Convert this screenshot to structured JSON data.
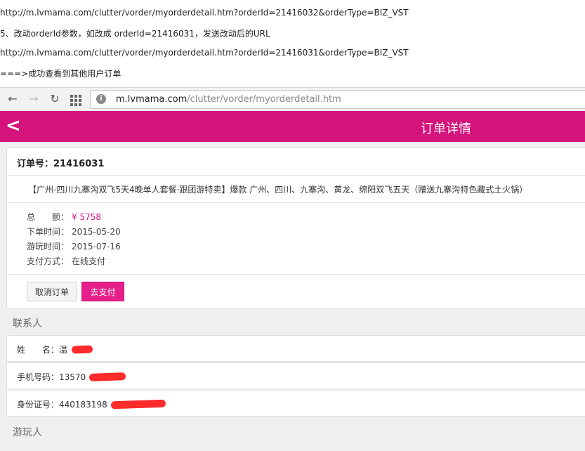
{
  "notes": {
    "line1": "http://m.lvmama.com/clutter/vorder/myorderdetail.htm?orderId=21416032&orderType=BIZ_VST",
    "line2": "5、改动orderId参数，如改成 orderId=21416031，发送改动后的URL",
    "line3": "http://m.lvmama.com/clutter/vorder/myorderdetail.htm?orderId=21416031&orderType=BIZ_VST",
    "line4": "===>成功查看到其他用户订单"
  },
  "browser": {
    "url_host": "m.lvmama.com",
    "url_path": "/clutter/vorder/myorderdetail.htm",
    "info_symbol": "i",
    "back_glyph": "←",
    "forward_glyph": "→",
    "reload_glyph": "↻"
  },
  "appbar": {
    "back_glyph": "<",
    "title": "订单详情",
    "color": "#d4137b"
  },
  "order": {
    "number_label": "订单号：21416031",
    "product": "【广州-四川九寨沟双飞5天4晚单人套餐·跟团游特卖】爆款 广州、四川、九寨沟、黄龙、绵阳双飞五天（赠送九寨沟特色藏式土火锅）",
    "total_label": "总　　额：",
    "total_value": "¥ 5758",
    "order_time_label": "下单时间：",
    "order_time_value": "2015-05-20",
    "travel_time_label": "游玩时间：",
    "travel_time_value": "2015-07-16",
    "pay_method_label": "支付方式：",
    "pay_method_value": "在线支付",
    "cancel_label": "取消订单",
    "pay_label": "去支付"
  },
  "contact": {
    "section_title": "联系人",
    "name_label": "姓　　名：温",
    "phone_label": "手机号码：13570",
    "id_label": "身份证号：440183198"
  },
  "traveler": {
    "section_title": "游玩人"
  }
}
